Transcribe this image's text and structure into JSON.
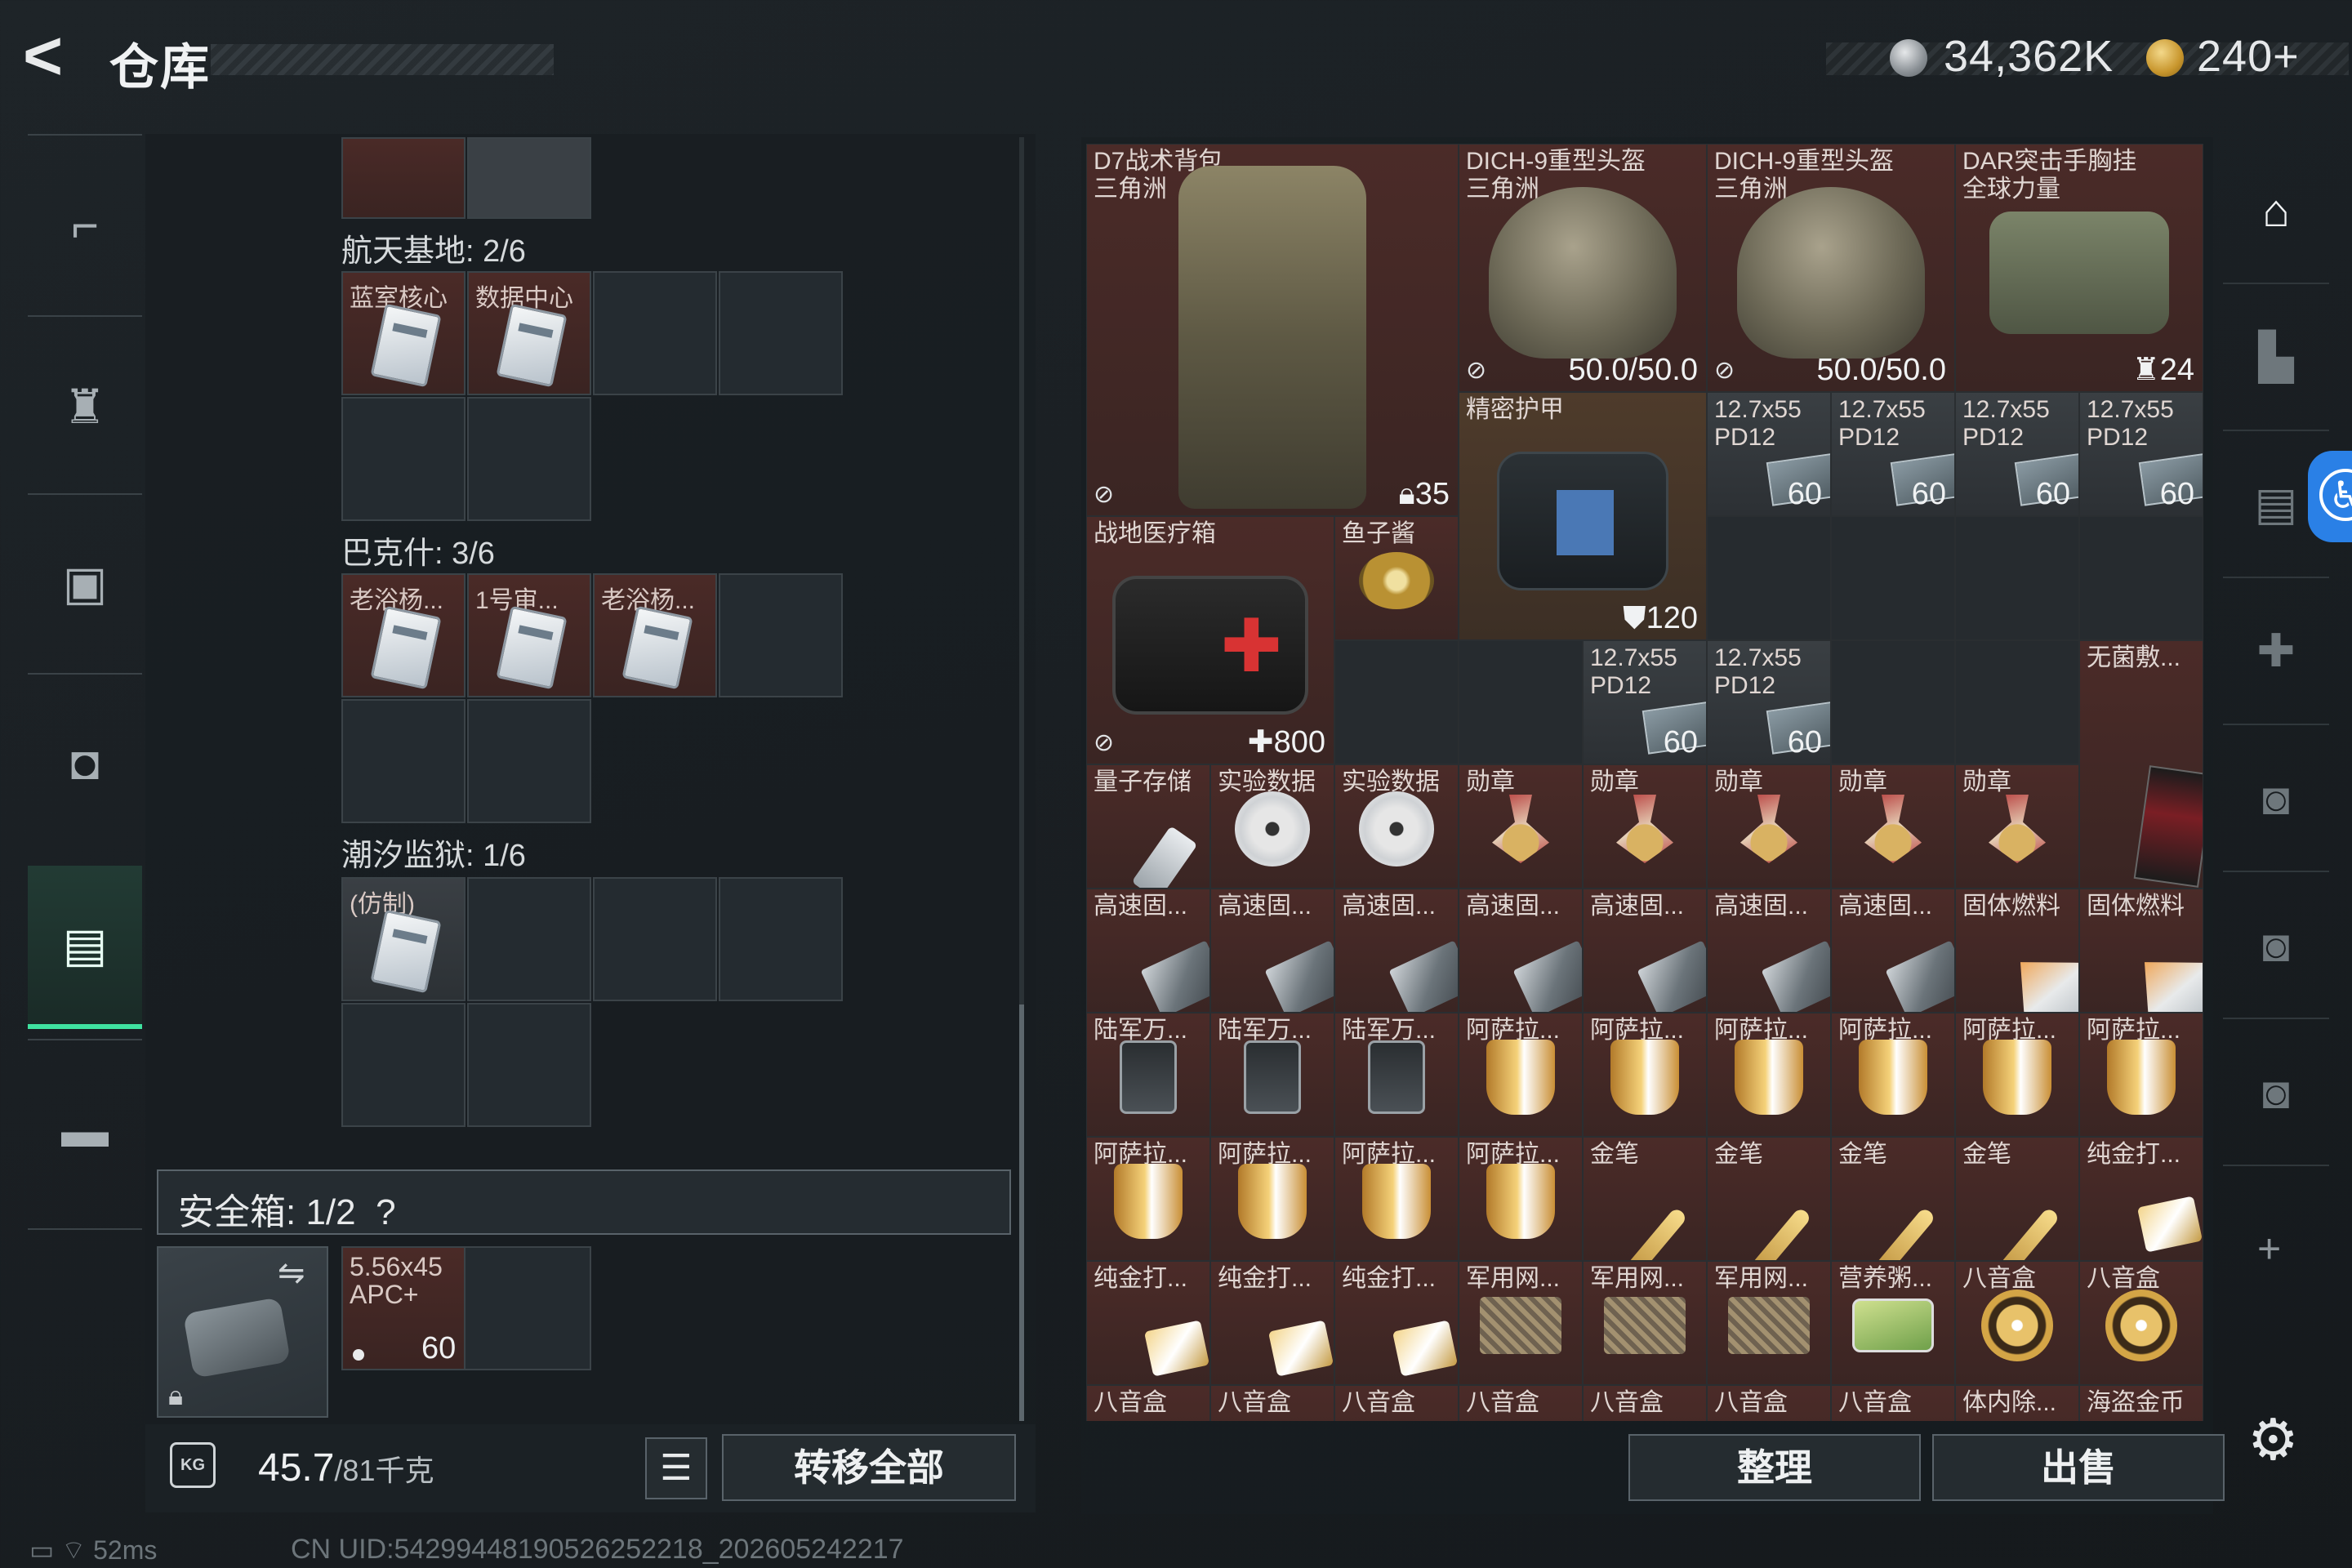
{
  "header": {
    "back_label": "<",
    "title": "仓库",
    "currency_silver": "34,362K",
    "currency_gold": "240+"
  },
  "nav": {
    "items": [
      {
        "icon": "gun-icon",
        "glyph": "⌐"
      },
      {
        "icon": "vest-icon",
        "glyph": "♜"
      },
      {
        "icon": "backpack-icon",
        "glyph": "▣"
      },
      {
        "icon": "pouch-icon",
        "glyph": "◘"
      },
      {
        "icon": "case-icon",
        "glyph": "▤"
      },
      {
        "icon": "briefcase-icon",
        "glyph": "▬"
      }
    ]
  },
  "left": {
    "sections": [
      {
        "label": "航天基地: 2/6",
        "items": [
          "蓝室核心",
          "数据中心"
        ]
      },
      {
        "label": "巴克什: 3/6",
        "items": [
          "老浴杨...",
          "1号审...",
          "老浴杨..."
        ]
      },
      {
        "label": "潮汐监狱: 1/6",
        "items": [
          "(仿制)"
        ]
      }
    ],
    "safe_label": "安全箱: 1/2",
    "safe_help": "?",
    "ammo_name": "5.56x45 APC+",
    "ammo_count": "60"
  },
  "bottom_left": {
    "kg_label": "KG",
    "weight": "45.7",
    "weight_max": "/81千克",
    "transfer_label": "转移全部"
  },
  "grid": {
    "backpack": {
      "name": "D7战术背包",
      "sub": "三角洲",
      "count": "35"
    },
    "helmet1": {
      "name": "DICH-9重型头盔",
      "sub": "三角洲",
      "count": "50.0/50.0"
    },
    "helmet2": {
      "name": "DICH-9重型头盔",
      "sub": "三角洲",
      "count": "50.0/50.0"
    },
    "vest": {
      "name": "DAR突击手胸挂",
      "sub": "全球力量",
      "count": "24"
    },
    "armor": {
      "name": "精密护甲",
      "count": "120"
    },
    "medkit": {
      "name": "战地医疗箱",
      "count": "800"
    },
    "caviar": {
      "name": "鱼子酱"
    },
    "gauze": {
      "name": "无菌敷..."
    },
    "ammo_name": "12.7x55",
    "ammo_sub": "PD12",
    "ammo_count": "60",
    "row_items": [
      "量子存储",
      "实验数据",
      "实验数据",
      "勋章",
      "勋章",
      "勋章",
      "勋章",
      "勋章",
      "高速固...",
      "高速固...",
      "高速固...",
      "高速固...",
      "高速固...",
      "高速固...",
      "高速固...",
      "固体燃料",
      "固体燃料",
      "陆军万...",
      "陆军万...",
      "陆军万...",
      "阿萨拉...",
      "阿萨拉...",
      "阿萨拉...",
      "阿萨拉...",
      "阿萨拉...",
      "阿萨拉...",
      "阿萨拉...",
      "阿萨拉...",
      "阿萨拉...",
      "阿萨拉...",
      "金笔",
      "金笔",
      "金笔",
      "金笔",
      "纯金打...",
      "纯金打...",
      "纯金打...",
      "纯金打...",
      "军用网...",
      "军用网...",
      "军用网...",
      "营养粥...",
      "八音盒",
      "八音盒",
      "八音盒",
      "八音盒",
      "八音盒",
      "八音盒",
      "八音盒",
      "八音盒",
      "八音盒",
      "体内除...",
      "海盗金币"
    ]
  },
  "right_buttons": {
    "sort_label": "整理",
    "sell_label": "出售"
  },
  "sidebar_right": {
    "items": [
      "home-icon",
      "tier3-vehicle-icon",
      "tier4-case-icon",
      "tier4-medical-icon",
      "tier4-box-icon",
      "tier4-box-icon",
      "tier4-box-icon"
    ],
    "plus": "+"
  },
  "status": {
    "ping": "52ms",
    "uid": "CN UID:5429944819052625221​8_202605242217"
  }
}
